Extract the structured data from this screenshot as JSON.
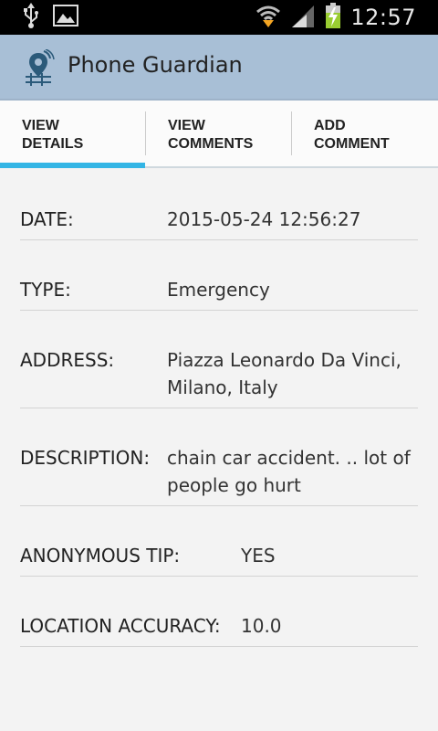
{
  "statusbar": {
    "time": "12:57",
    "left_icons": [
      "usb-icon",
      "gallery-icon"
    ],
    "right_icons": [
      "wifi-icon",
      "signal-icon",
      "battery-charging-icon"
    ]
  },
  "actionbar": {
    "title": "Phone Guardian",
    "icon": "location-pin-icon",
    "background": "#a8bfd6"
  },
  "tabs": [
    {
      "label_line1": "VIEW",
      "label_line2": "DETAILS",
      "selected": true
    },
    {
      "label_line1": "VIEW",
      "label_line2": "COMMENTS",
      "selected": false
    },
    {
      "label_line1": "ADD",
      "label_line2": "COMMENT",
      "selected": false
    }
  ],
  "accent": "#33b5e5",
  "details": {
    "date_label": "DATE:",
    "date_value": "2015-05-24 12:56:27",
    "type_label": "TYPE:",
    "type_value": "Emergency",
    "address_label": "ADDRESS:",
    "address_line1": "Piazza Leonardo Da Vinci,",
    "address_line2": "Milano, Italy",
    "description_label": "DESCRIPTION:",
    "description_line1": "chain car accident. .. lot of",
    "description_line2": "people go hurt",
    "anonymous_label": "ANONYMOUS TIP:",
    "anonymous_value": "YES",
    "accuracy_label": "LOCATION ACCURACY:",
    "accuracy_value": "10.0"
  }
}
